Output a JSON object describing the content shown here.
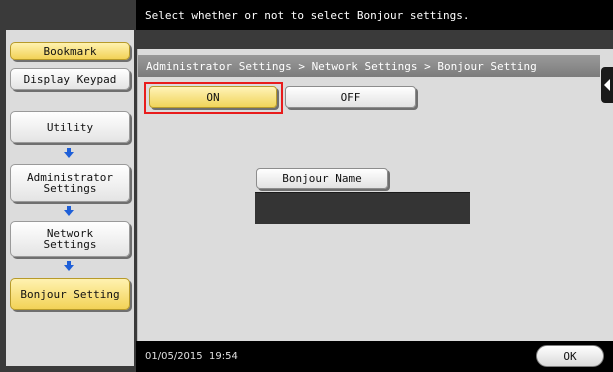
{
  "message_bar": {
    "text": "Select whether or not to select Bonjour settings."
  },
  "left_nav": {
    "bookmark_label": "Bookmark",
    "display_keypad_label": "Display Keypad",
    "utility_label": "Utility",
    "administrator_settings_label": "Administrator\nSettings",
    "network_settings_label": "Network\nSettings",
    "bonjour_setting_label": "Bonjour Setting"
  },
  "breadcrumb": {
    "text": "Administrator Settings > Network Settings > Bonjour Setting"
  },
  "toggle": {
    "on_label": "ON",
    "off_label": "OFF",
    "selected": "ON"
  },
  "bonjour_name": {
    "button_label": "Bonjour Name",
    "value": ""
  },
  "status": {
    "datetime": "01/05/2015  19:54"
  },
  "ok_button": {
    "label": "OK"
  },
  "colors": {
    "selected_yellow": "#f0d45a",
    "highlight_red": "#e81c1c",
    "arrow_blue": "#1e5fd8"
  }
}
